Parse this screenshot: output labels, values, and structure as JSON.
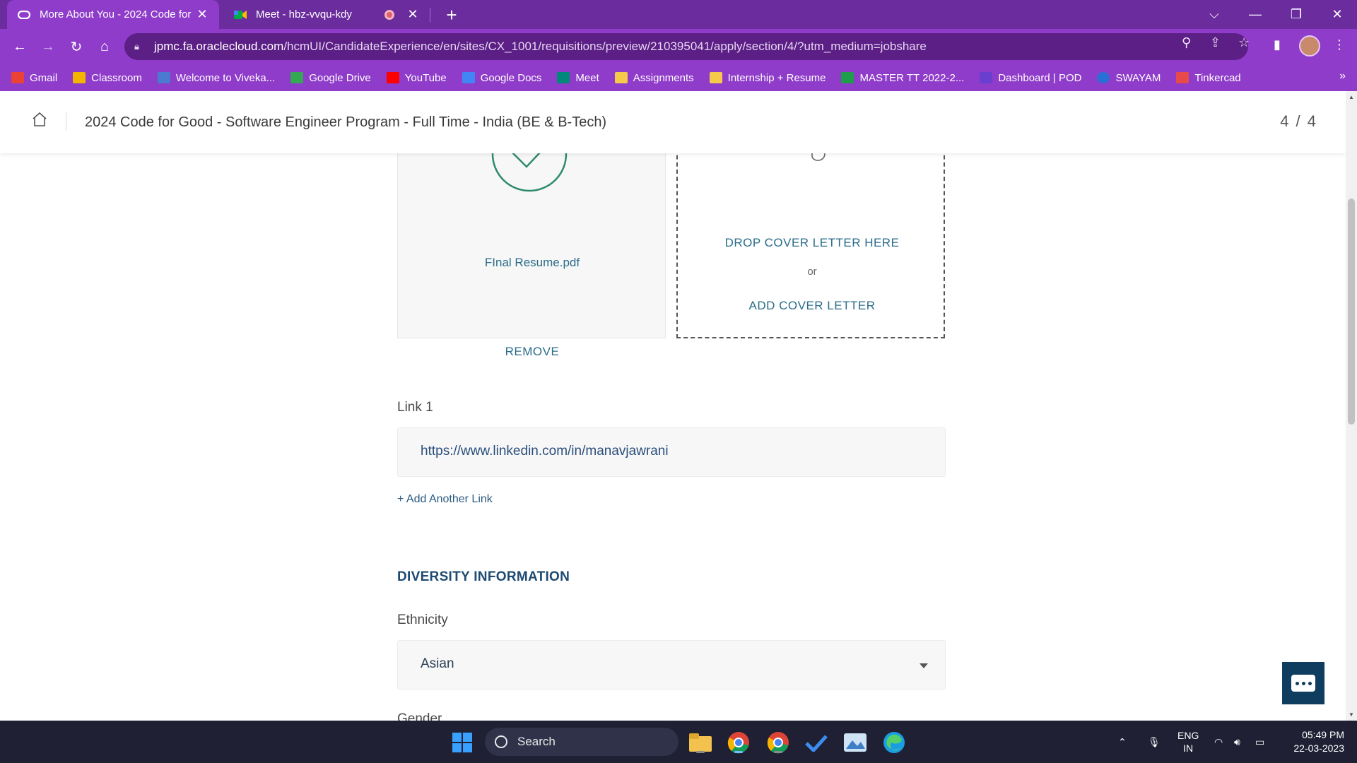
{
  "browser": {
    "tabs": [
      {
        "title": "More About You - 2024 Code for",
        "active": true
      },
      {
        "title": "Meet - hbz-vvqu-kdy",
        "active": false
      }
    ],
    "url_host": "jpmc.fa.oraclecloud.com",
    "url_path": "/hcmUI/CandidateExperience/en/sites/CX_1001/requisitions/preview/210395041/apply/section/4/?utm_medium=jobshare",
    "bookmarks": [
      {
        "label": "Gmail",
        "color": "#ea4335"
      },
      {
        "label": "Classroom",
        "color": "#f4b400"
      },
      {
        "label": "Welcome to Viveka...",
        "color": "#4a7bd0"
      },
      {
        "label": "Google Drive",
        "color": "#34a853"
      },
      {
        "label": "YouTube",
        "color": "#ff0000"
      },
      {
        "label": "Google Docs",
        "color": "#4285f4"
      },
      {
        "label": "Meet",
        "color": "#00897b"
      },
      {
        "label": "Assignments",
        "color": "#f6c94b"
      },
      {
        "label": "Internship + Resume",
        "color": "#f6c94b"
      },
      {
        "label": "MASTER TT 2022-2...",
        "color": "#1e9e4a"
      },
      {
        "label": "Dashboard | POD",
        "color": "#6a3fd0"
      },
      {
        "label": "SWAYAM",
        "color": "#2a6fd6"
      },
      {
        "label": "Tinkercad",
        "color": "#e84a4a"
      }
    ]
  },
  "header": {
    "job_title": "2024 Code for Good - Software Engineer Program - Full Time - India (BE & B-Tech)",
    "step": "4 / 4"
  },
  "resume": {
    "file_name": "FInal Resume.pdf",
    "remove_label": "REMOVE"
  },
  "cover_letter": {
    "drop_label": "DROP COVER LETTER HERE",
    "or_label": "or",
    "add_label": "ADD COVER LETTER"
  },
  "links": {
    "label": "Link 1",
    "value": "https://www.linkedin.com/in/manavjawrani",
    "add_label": "+  Add Another Link"
  },
  "diversity": {
    "title": "DIVERSITY INFORMATION",
    "ethnicity_label": "Ethnicity",
    "ethnicity_value": "Asian",
    "gender_label": "Gender"
  },
  "taskbar": {
    "search_label": "Search",
    "lang_top": "ENG",
    "lang_bottom": "IN",
    "time": "05:49 PM",
    "date": "22-03-2023"
  },
  "colors": {
    "browser_frame": "#8e3cc9",
    "link_text": "#2a6c8a",
    "section_title": "#1d4a72",
    "chat_button": "#0f3d5f"
  }
}
